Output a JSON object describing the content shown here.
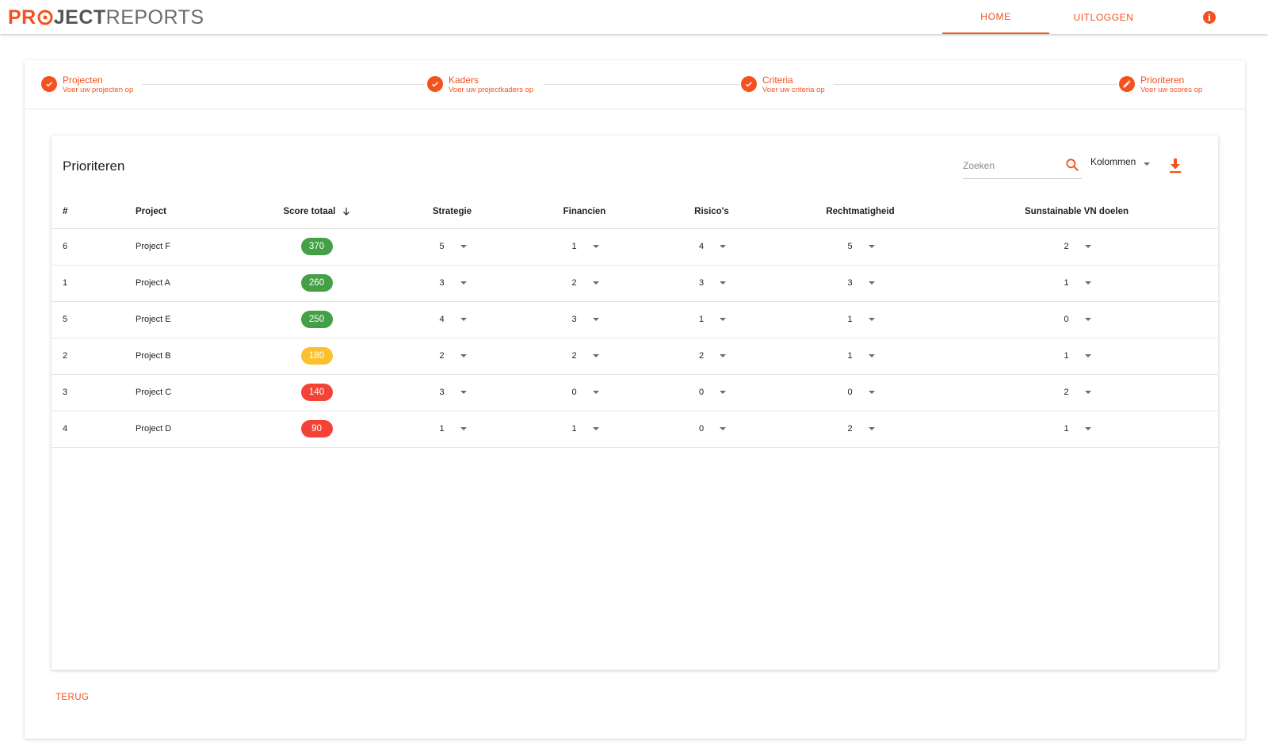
{
  "app": {
    "logo_part1": "PR",
    "logo_part2": "JECT",
    "logo_part3": "REPORTS"
  },
  "nav": {
    "home": "HOME",
    "logout": "UITLOGGEN",
    "info_icon": "info-icon"
  },
  "stepper": [
    {
      "title": "Projecten",
      "subtitle": "Voer uw projecten op",
      "icon": "check-icon"
    },
    {
      "title": "Kaders",
      "subtitle": "Voer uw projectkaders op",
      "icon": "check-icon"
    },
    {
      "title": "Criteria",
      "subtitle": "Voer uw criteria op",
      "icon": "check-icon"
    },
    {
      "title": "Prioriteren",
      "subtitle": "Voer uw scores op",
      "icon": "pencil-icon"
    }
  ],
  "panel": {
    "title": "Prioriteren",
    "search_placeholder": "Zoeken",
    "columns_label": "Kolommen"
  },
  "table": {
    "headers": [
      "#",
      "Project",
      "Score totaal",
      "Strategie",
      "Financien",
      "Risico's",
      "Rechtmatigheid",
      "Sunstainable VN doelen"
    ],
    "sort_column": "Score totaal",
    "sort_direction": "descending",
    "rows": [
      {
        "num": "6",
        "project": "Project F",
        "score": "370",
        "strategie": "5",
        "financien": "1",
        "risicos": "4",
        "rechtmatigheid": "5",
        "vn_doelen": "2"
      },
      {
        "num": "1",
        "project": "Project A",
        "score": "260",
        "strategie": "3",
        "financien": "2",
        "risicos": "3",
        "rechtmatigheid": "3",
        "vn_doelen": "1"
      },
      {
        "num": "5",
        "project": "Project E",
        "score": "250",
        "strategie": "4",
        "financien": "3",
        "risicos": "1",
        "rechtmatigheid": "1",
        "vn_doelen": "0"
      },
      {
        "num": "2",
        "project": "Project B",
        "score": "180",
        "strategie": "2",
        "financien": "2",
        "risicos": "2",
        "rechtmatigheid": "1",
        "vn_doelen": "1"
      },
      {
        "num": "3",
        "project": "Project C",
        "score": "140",
        "strategie": "3",
        "financien": "0",
        "risicos": "0",
        "rechtmatigheid": "0",
        "vn_doelen": "2"
      },
      {
        "num": "4",
        "project": "Project D",
        "score": "90",
        "strategie": "1",
        "financien": "1",
        "risicos": "0",
        "rechtmatigheid": "2",
        "vn_doelen": "1"
      }
    ]
  },
  "footer": {
    "back_label": "TERUG"
  },
  "colors": {
    "accent": "#f4511e",
    "score_high": "#43a047",
    "score_mid": "#fbc02d",
    "score_low": "#f44336"
  }
}
